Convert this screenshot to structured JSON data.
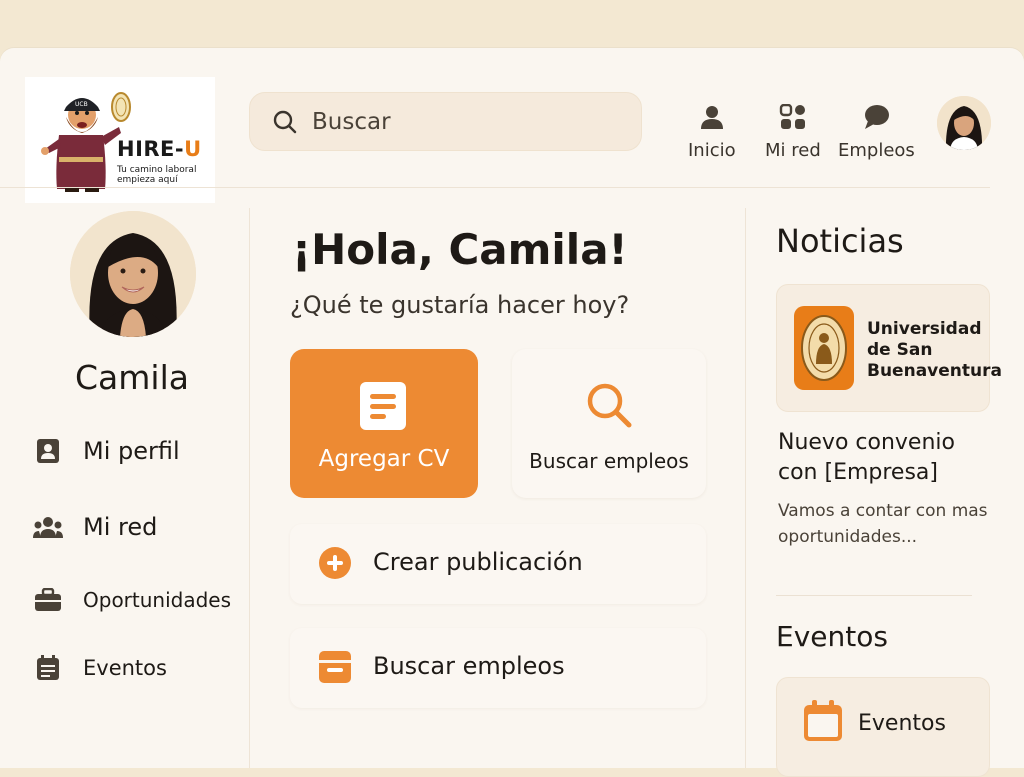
{
  "brand": {
    "name_part1": "HIRE-",
    "name_part2": "U",
    "tagline": "Tu camino laboral empieza aquí",
    "accent_color": "#e87d18"
  },
  "search": {
    "placeholder": "Buscar",
    "value": ""
  },
  "topnav": {
    "items": [
      {
        "label": "Inicio",
        "icon": "home-person-icon"
      },
      {
        "label": "Mi red",
        "icon": "network-grid-icon"
      },
      {
        "label": "Empleos",
        "icon": "chat-bubble-icon"
      }
    ]
  },
  "profile": {
    "name": "Camila"
  },
  "sidebar": {
    "items": [
      {
        "label": "Mi perfil",
        "icon": "profile-card-icon"
      },
      {
        "label": "Mi red",
        "icon": "people-icon"
      },
      {
        "label": "Oportunidades",
        "icon": "briefcase-icon"
      },
      {
        "label": "Eventos",
        "icon": "calendar-note-icon"
      }
    ]
  },
  "main": {
    "greeting": "¡Hola, Camila!",
    "subgreeting": "¿Qué te gustaría hacer hoy?",
    "cards": [
      {
        "label": "Agregar CV",
        "icon": "document-icon"
      },
      {
        "label": "Buscar empleos",
        "icon": "search-icon"
      }
    ],
    "rows": [
      {
        "label": "Crear publicación",
        "icon": "plus-circle-icon"
      },
      {
        "label": "Buscar empleos",
        "icon": "list-icon"
      }
    ]
  },
  "news": {
    "title": "Noticias",
    "university": [
      "Universidad",
      "de San",
      "Buenaventura"
    ],
    "headline": "Nuevo convenio con [Empresa]",
    "body": "Vamos a contar con mas oportunidades..."
  },
  "events": {
    "title": "Eventos",
    "card_label": "Eventos"
  },
  "colors": {
    "accent": "#ed8a33",
    "background": "#faf6f0",
    "frame": "#f3e8d2"
  }
}
